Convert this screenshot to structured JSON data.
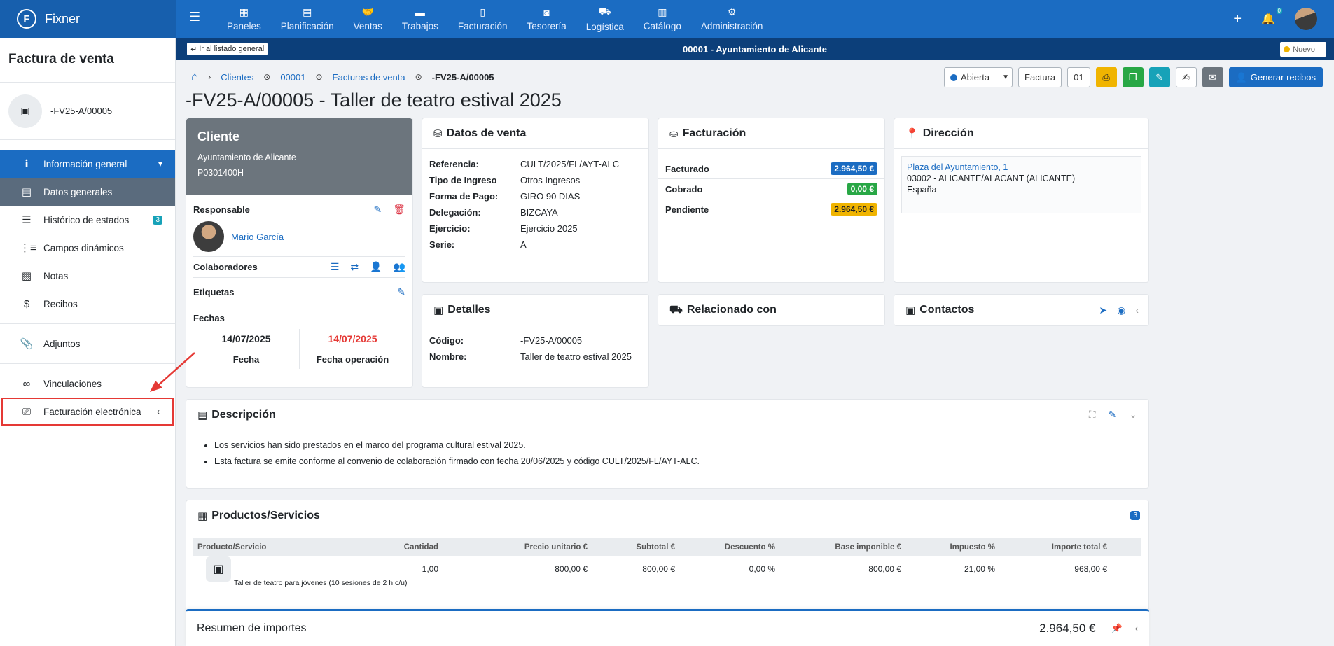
{
  "app": {
    "name": "Fixner",
    "logo_letter": "F"
  },
  "topnav": [
    {
      "label": "Paneles",
      "icon": "▦"
    },
    {
      "label": "Planificación",
      "icon": "▤"
    },
    {
      "label": "Ventas",
      "icon": "🤝"
    },
    {
      "label": "Trabajos",
      "icon": "▬"
    },
    {
      "label": "Facturación",
      "icon": "▯"
    },
    {
      "label": "Tesorería",
      "icon": "◙"
    },
    {
      "label": "Logística",
      "icon": "⛟"
    },
    {
      "label": "Catálogo",
      "icon": "▥"
    },
    {
      "label": "Administración",
      "icon": "⚙"
    }
  ],
  "notifications": {
    "count": "0"
  },
  "subbar": {
    "back_label": "Ir al listado general",
    "title": "00001 - Ayuntamiento de Alicante",
    "status": "Nuevo"
  },
  "sidebar": {
    "title": "Factura de venta",
    "doc_code": "-FV25-A/00005",
    "items": [
      {
        "label": "Información general"
      },
      {
        "label": "Datos generales"
      },
      {
        "label": "Histórico de estados",
        "badge": "3"
      },
      {
        "label": "Campos dinámicos"
      },
      {
        "label": "Notas"
      },
      {
        "label": "Recibos"
      },
      {
        "label": "Adjuntos"
      },
      {
        "label": "Vinculaciones"
      },
      {
        "label": "Facturación electrónica"
      }
    ]
  },
  "breadcrumb": {
    "clientes": "Clientes",
    "code": "00001",
    "facturas": "Facturas de venta",
    "current": "-FV25-A/00005"
  },
  "page_title": "-FV25-A/00005 - Taller de teatro estival 2025",
  "toolbar": {
    "status": "Abierta",
    "type": "Factura",
    "series": "01",
    "primary": "Generar recibos"
  },
  "client": {
    "title": "Cliente",
    "name": "Ayuntamiento de Alicante",
    "nif": "P0301400H",
    "responsable_label": "Responsable",
    "responsable_name": "Mario García",
    "colaboradores_label": "Colaboradores",
    "etiquetas_label": "Etiquetas",
    "fechas_label": "Fechas",
    "fecha": "14/07/2025",
    "fecha_label": "Fecha",
    "fecha_op": "14/07/2025",
    "fecha_op_label": "Fecha operación"
  },
  "venta": {
    "title": "Datos de venta",
    "rows": [
      {
        "k": "Referencia:",
        "v": "CULT/2025/FL/AYT-ALC"
      },
      {
        "k": "Tipo de Ingreso",
        "v": "Otros Ingresos"
      },
      {
        "k": "Forma de Pago:",
        "v": "GIRO 90 DIAS"
      },
      {
        "k": "Delegación:",
        "v": "BIZCAYA"
      },
      {
        "k": "Ejercicio:",
        "v": "Ejercicio 2025"
      },
      {
        "k": "Serie:",
        "v": "A"
      }
    ]
  },
  "detalles": {
    "title": "Detalles",
    "rows": [
      {
        "k": "Código:",
        "v": "-FV25-A/00005"
      },
      {
        "k": "Nombre:",
        "v": "Taller de teatro estival 2025"
      }
    ]
  },
  "facturacion": {
    "title": "Facturación",
    "rows": [
      {
        "k": "Facturado",
        "v": "2.964,50 €",
        "color": "#1b6cc2"
      },
      {
        "k": "Cobrado",
        "v": "0,00 €",
        "color": "#28a745"
      },
      {
        "k": "Pendiente",
        "v": "2.964,50 €",
        "color": "#f0b400"
      }
    ]
  },
  "relacionado": {
    "title": "Relacionado con"
  },
  "direccion": {
    "title": "Dirección",
    "street": "Plaza del Ayuntamiento, 1",
    "city": "03002 - ALICANTE/ALACANT (ALICANTE)",
    "country": "España"
  },
  "contactos": {
    "title": "Contactos"
  },
  "descripcion": {
    "title": "Descripción",
    "items": [
      "Los servicios han sido prestados en el marco del programa cultural estival 2025.",
      "Esta factura se emite conforme al convenio de colaboración firmado con fecha 20/06/2025 y código CULT/2025/FL/AYT-ALC."
    ]
  },
  "productos": {
    "title": "Productos/Servicios",
    "count": "3",
    "columns": [
      "Producto/Servicio",
      "Cantidad",
      "Precio unitario €",
      "Subtotal €",
      "Descuento %",
      "Base imponible €",
      "Impuesto %",
      "Importe total €"
    ],
    "rows": [
      {
        "cantidad": "1,00",
        "precio": "800,00 €",
        "subtotal": "800,00 €",
        "descuento": "0,00 %",
        "base": "800,00 €",
        "impuesto": "21,00 %",
        "total": "968,00 €",
        "desc": "Taller de teatro para jóvenes (10 sesiones de 2 h c/u)"
      }
    ]
  },
  "resumen": {
    "title": "Resumen de importes",
    "total": "2.964,50 €"
  },
  "colors": {
    "primary": "#1b6cc2",
    "navy": "#0c3f7a",
    "highlight": "#e53935"
  }
}
